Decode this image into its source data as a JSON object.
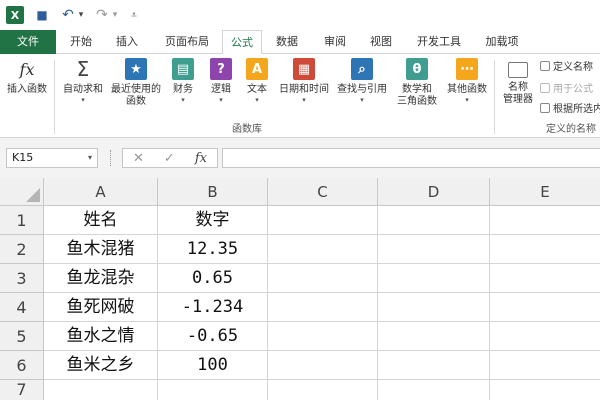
{
  "quick_access": {
    "app_icon": "excel-logo",
    "save_icon": "save-icon",
    "undo_icon": "undo-icon",
    "redo_icon": "redo-icon",
    "customize_icon": "customize-toolbar-icon",
    "app_letter": "X",
    "save_glyph": "■",
    "undo_glyph": "↶",
    "redo_glyph": "↷",
    "caret_glyph": "▾",
    "customize_glyph": "⩡"
  },
  "tabs": [
    {
      "label": "文件"
    },
    {
      "label": "开始"
    },
    {
      "label": "插入"
    },
    {
      "label": "页面布局"
    },
    {
      "label": "公式"
    },
    {
      "label": "数据"
    },
    {
      "label": "审阅"
    },
    {
      "label": "视图"
    },
    {
      "label": "开发工具"
    },
    {
      "label": "加载项"
    }
  ],
  "ribbon": {
    "function_library": {
      "group_label": "函数库",
      "insert_function": {
        "label": "插入函数",
        "glyph": "fx"
      },
      "autosum": {
        "label": "自动求和",
        "glyph": "Σ"
      },
      "recent": {
        "label1": "最近使用的",
        "label2": "函数",
        "glyph": "★"
      },
      "financial": {
        "label": "财务",
        "glyph": "▤"
      },
      "logical": {
        "label": "逻辑",
        "glyph": "?"
      },
      "text": {
        "label": "文本",
        "glyph": "A"
      },
      "datetime": {
        "label": "日期和时间",
        "glyph": "▦"
      },
      "lookup": {
        "label": "查找与引用",
        "glyph": "⌕"
      },
      "math": {
        "label1": "数学和",
        "label2": "三角函数",
        "glyph": "θ"
      },
      "more": {
        "label": "其他函数",
        "glyph": "⋯"
      },
      "caret": "▾"
    },
    "defined_names": {
      "group_label": "定义的名称",
      "name_manager": {
        "label1": "名称",
        "label2": "管理器"
      },
      "define_name": "定义名称",
      "use_in_formula": "用于公式",
      "create_from_selection": "根据所选内"
    }
  },
  "formula_bar": {
    "name_box": "K15",
    "name_box_caret": "▾",
    "cancel_glyph": "✕",
    "enter_glyph": "✓",
    "fx_glyph": "fx",
    "formula_value": ""
  },
  "sheet": {
    "columns": [
      "A",
      "B",
      "C",
      "D",
      "E"
    ],
    "rows": [
      {
        "num": "1",
        "A": "姓名",
        "B": "数字"
      },
      {
        "num": "2",
        "A": "鱼木混猪",
        "B": "12.35"
      },
      {
        "num": "3",
        "A": "鱼龙混杂",
        "B": "0.65"
      },
      {
        "num": "4",
        "A": "鱼死网破",
        "B": "-1.234"
      },
      {
        "num": "5",
        "A": "鱼水之情",
        "B": "-0.65"
      },
      {
        "num": "6",
        "A": "鱼米之乡",
        "B": "100"
      },
      {
        "num": "7",
        "A": "",
        "B": ""
      }
    ]
  },
  "colors": {
    "excel_green": "#217346",
    "ribbon_icon_blue": "#2e75b6",
    "ribbon_icon_purple": "#8e44ad",
    "ribbon_icon_orange": "#f4a71d",
    "ribbon_icon_red": "#d04a3a",
    "ribbon_icon_teal": "#3f9e8f"
  }
}
